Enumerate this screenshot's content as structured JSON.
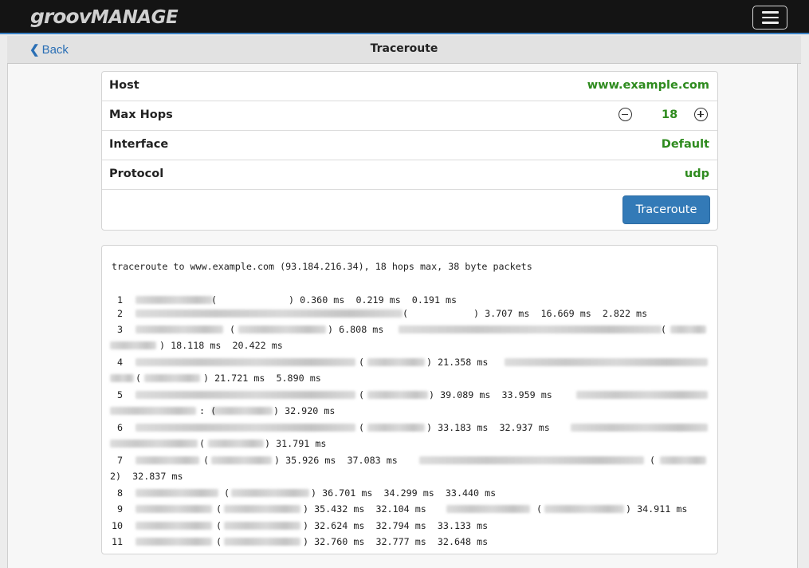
{
  "app": {
    "logo_groov": "groov",
    "logo_manage": "MANAGE",
    "menu_icon": "hamburger-icon"
  },
  "nav": {
    "back_label": "Back",
    "back_icon": "chevron-left-icon",
    "title": "Traceroute"
  },
  "settings": {
    "host": {
      "label": "Host",
      "value": "www.example.com"
    },
    "max_hops": {
      "label": "Max Hops",
      "value": "18",
      "minus_icon": "minus-circle-icon",
      "plus_icon": "plus-circle-icon"
    },
    "interface": {
      "label": "Interface",
      "value": "Default"
    },
    "protocol": {
      "label": "Protocol",
      "value": "udp"
    },
    "button_label": "Traceroute"
  },
  "colors": {
    "accent": "#2e8b1e",
    "button": "#337ab7",
    "link": "#2a6fb5"
  },
  "output": {
    "header": "traceroute to www.example.com (93.184.216.34), 18 hops max, 38 byte packets",
    "lines": [
      {
        "n": "1",
        "t1": "(",
        "t2": ") 0.360 ms  0.219 ms  0.191 ms"
      },
      {
        "n": "2",
        "t1": "(",
        "t2": ") 3.707 ms  16.669 ms  2.822 ms"
      },
      {
        "n": "3",
        "t1": "(",
        "t2": ") 6.808 ms",
        "t3": "("
      },
      {
        "n": "",
        "t1": ") 18.118 ms  20.422 ms"
      },
      {
        "n": "4",
        "t1": "(",
        "t2": ") 21.358 ms"
      },
      {
        "n": "",
        "t1": "(",
        "t2": ") 21.721 ms  5.890 ms"
      },
      {
        "n": "5",
        "t1": "(",
        "t2": ") 39.089 ms  33.959 ms"
      },
      {
        "n": "",
        "t1": ": (",
        "t2": ") 32.920 ms"
      },
      {
        "n": "6",
        "t1": "(",
        "t2": ") 33.183 ms  32.937 ms"
      },
      {
        "n": "",
        "t1": "(",
        "t2": ") 31.791 ms"
      },
      {
        "n": "7",
        "t1": "(",
        "t2": ") 35.926 ms  37.083 ms",
        "t3": "("
      },
      {
        "n": "",
        "t1": "2)  32.837 ms"
      },
      {
        "n": "8",
        "t1": "(",
        "t2": ") 36.701 ms  34.299 ms  33.440 ms"
      },
      {
        "n": "9",
        "t1": "(",
        "t2": ") 35.432 ms  32.104 ms",
        "t3": "(",
        "t4": ") 34.911 ms"
      },
      {
        "n": "10",
        "t1": "(",
        "t2": ") 32.624 ms  32.794 ms  33.133 ms"
      },
      {
        "n": "11",
        "t1": "(",
        "t2": ") 32.760 ms  32.777 ms  32.648 ms"
      }
    ]
  }
}
